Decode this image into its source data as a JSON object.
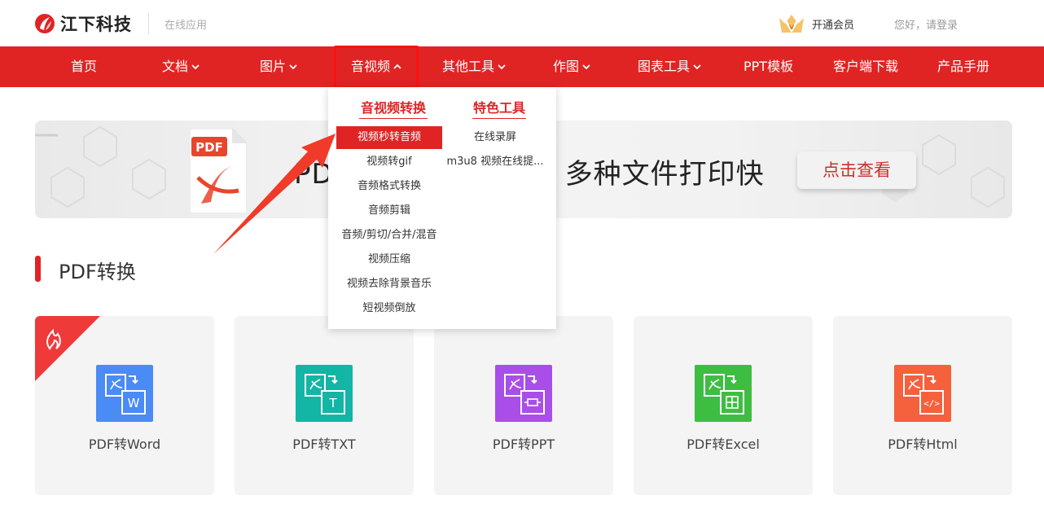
{
  "header": {
    "brand": "江下科技",
    "subtitle": "在线应用",
    "vip_label": "开通会员",
    "login_label": "您好，请登录"
  },
  "nav": {
    "items": [
      {
        "label": "首页",
        "has_dropdown": false
      },
      {
        "label": "文档",
        "has_dropdown": true
      },
      {
        "label": "图片",
        "has_dropdown": true
      },
      {
        "label": "音视频",
        "has_dropdown": true,
        "open": true
      },
      {
        "label": "其他工具",
        "has_dropdown": true
      },
      {
        "label": "作图",
        "has_dropdown": true
      },
      {
        "label": "图表工具",
        "has_dropdown": true
      },
      {
        "label": "PPT模板",
        "has_dropdown": false
      },
      {
        "label": "客户端下载",
        "has_dropdown": false
      },
      {
        "label": "产品手册",
        "has_dropdown": false
      }
    ]
  },
  "dropdown": {
    "col1_title": "音视频转换",
    "col2_title": "特色工具",
    "col1_items": [
      "视频秒转音频",
      "视频转gif",
      "音频格式转换",
      "音频剪辑",
      "音频/剪切/合并/混音",
      "视频压缩",
      "视频去除背景音乐",
      "短视频倒放"
    ],
    "col2_items": [
      "在线录屏",
      "m3u8 视频在线提..."
    ]
  },
  "banner": {
    "title_left": "PD",
    "title_right": "多种文件打印快",
    "button": "点击查看",
    "doc_label": "PDF"
  },
  "section": {
    "title": "PDF转换"
  },
  "cards": [
    {
      "label": "PDF转Word",
      "color": "#4a8bf5",
      "badge": "W"
    },
    {
      "label": "PDF转TXT",
      "color": "#13b5a4",
      "badge": "T"
    },
    {
      "label": "PDF转PPT",
      "color": "#a94ee8",
      "badge": "ppt"
    },
    {
      "label": "PDF转Excel",
      "color": "#3ebd43",
      "badge": "grid"
    },
    {
      "label": "PDF转Html",
      "color": "#f5603d",
      "badge": "</>"
    }
  ],
  "colors": {
    "brand_red": "#e02424",
    "annotation_red": "#ff1010"
  }
}
